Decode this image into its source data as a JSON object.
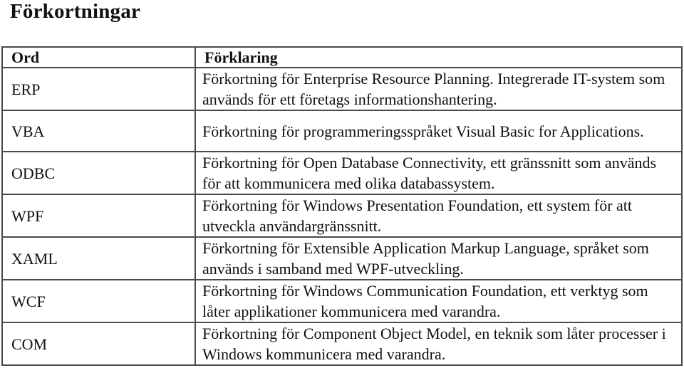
{
  "page": {
    "title": "Förkortningar"
  },
  "table": {
    "headers": {
      "word": "Ord",
      "explanation": "Förklaring"
    },
    "rows": [
      {
        "word": "ERP",
        "explanation": "Förkortning för Enterprise Resource Planning. Integrerade IT-system som används för ett företags informationshantering."
      },
      {
        "word": "VBA",
        "explanation": "Förkortning för programmeringsspråket Visual Basic for Applications."
      },
      {
        "word": "ODBC",
        "explanation": "Förkortning för Open Database Connectivity, ett gränssnitt som används för att kommunicera med olika databassystem."
      },
      {
        "word": "WPF",
        "explanation": "Förkortning för Windows Presentation Foundation, ett system för att utveckla användargränssnitt."
      },
      {
        "word": "XAML",
        "explanation": "Förkortning för Extensible Application Markup Language, språket som används i samband med WPF-utveckling."
      },
      {
        "word": "WCF",
        "explanation": "Förkortning för Windows Communication Foundation, ett verktyg som låter applikationer kommunicera med varandra."
      },
      {
        "word": "COM",
        "explanation": "Förkortning för Component Object Model, en teknik som låter processer i Windows kommunicera med varandra."
      }
    ]
  }
}
